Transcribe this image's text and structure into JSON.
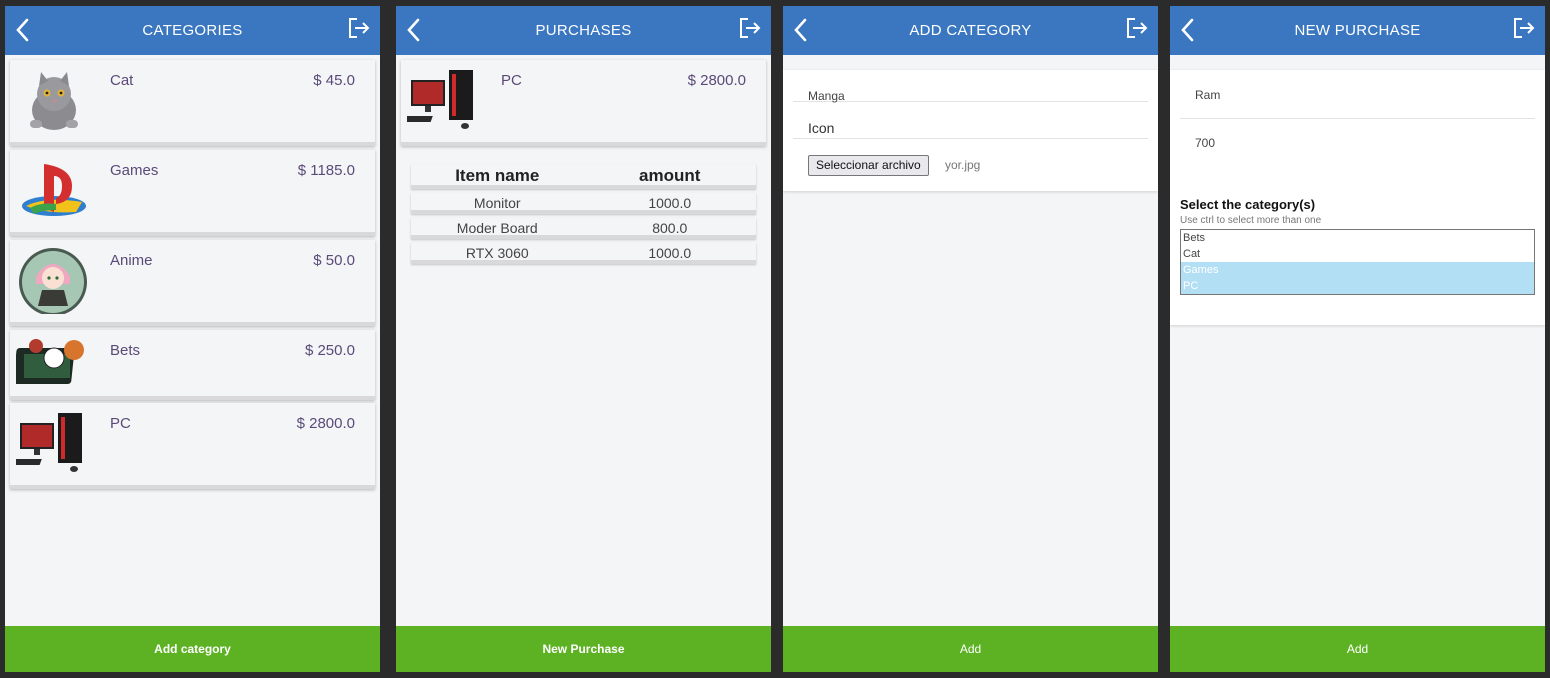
{
  "categories_screen": {
    "title": "CATEGORIES",
    "items": [
      {
        "name": "Cat",
        "price": "$ 45.0"
      },
      {
        "name": "Games",
        "price": "$ 1185.0"
      },
      {
        "name": "Anime",
        "price": "$ 50.0"
      },
      {
        "name": "Bets",
        "price": "$ 250.0"
      },
      {
        "name": "PC",
        "price": "$ 2800.0"
      }
    ],
    "bottom_button": "Add category"
  },
  "purchases_screen": {
    "title": "PURCHASES",
    "category": {
      "name": "PC",
      "price": "$ 2800.0"
    },
    "table": {
      "headers": [
        "Item name",
        "amount"
      ],
      "rows": [
        [
          "Monitor",
          "1000.0"
        ],
        [
          "Moder Board",
          "800.0"
        ],
        [
          "RTX 3060",
          "1000.0"
        ]
      ]
    },
    "bottom_button": "New Purchase"
  },
  "add_category_screen": {
    "title": "ADD CATEGORY",
    "name_value": "Manga",
    "icon_label": "Icon",
    "file_button": "Seleccionar archivo",
    "file_name": "yor.jpg",
    "bottom_button": "Add"
  },
  "new_purchase_screen": {
    "title": "NEW PURCHASE",
    "item_name_value": "Ram",
    "amount_value": "700",
    "select_label": "Select the category(s)",
    "select_hint": "Use ctrl to select more than one",
    "options": [
      {
        "label": "Bets",
        "selected": false
      },
      {
        "label": "Cat",
        "selected": false
      },
      {
        "label": "Games",
        "selected": true
      },
      {
        "label": "PC",
        "selected": true
      }
    ],
    "bottom_button": "Add"
  },
  "colors": {
    "appbar": "#3a77c0",
    "button": "#5db223",
    "price_text": "#5b4a78",
    "selected_option": "#b3dff5"
  },
  "icons": [
    "chevron-left-icon",
    "logout-icon",
    "cat-thumbnail",
    "playstation-thumbnail",
    "anime-thumbnail",
    "bets-thumbnail",
    "pc-thumbnail"
  ]
}
